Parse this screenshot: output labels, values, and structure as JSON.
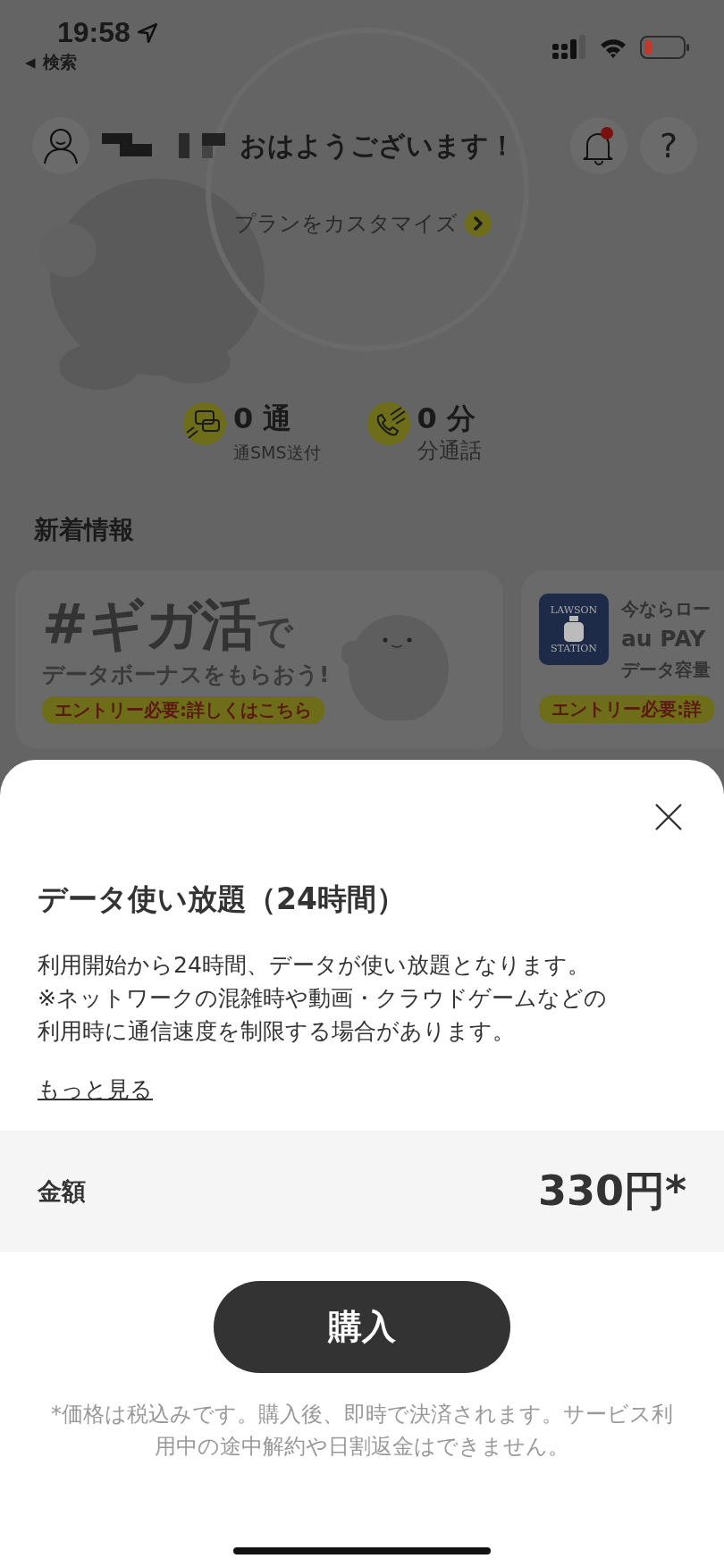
{
  "status_bar": {
    "time": "19:58",
    "back_arrow": "◀",
    "back_label": "検索"
  },
  "header": {
    "greeting": "おはようございます！",
    "notification_unread": true,
    "help_label": "?"
  },
  "plan": {
    "customize_label": "プランをカスタマイズ"
  },
  "stats": [
    {
      "kind": "sms",
      "value": "0 通",
      "label": "通SMS送付"
    },
    {
      "kind": "call",
      "value": "0 分",
      "label": "分通話"
    }
  ],
  "news": {
    "title": "新着情報",
    "cards": [
      {
        "kind": "giga",
        "headline": "#ギガ活",
        "headline_suffix": "で",
        "subline": "データボーナスをもらおう!",
        "badge": "エントリー必要:詳しくはこちら"
      },
      {
        "kind": "lawson",
        "logo_top": "LAWSON",
        "logo_bottom": "STATION",
        "lines": [
          "今ならロー",
          "au PAY",
          "データ容量"
        ],
        "badge": "エントリー必要:詳"
      }
    ]
  },
  "sheet": {
    "title": "データ使い放題（24時間）",
    "description": [
      "利用開始から24時間、データが使い放題となります。",
      "※ネットワークの混雑時や動画・クラウドゲームなどの",
      "利用時に通信速度を制限する場合があります。"
    ],
    "more_link": "もっと見る",
    "price_label": "金額",
    "price": "330円*",
    "buy_button": "購入",
    "footnote": "*価格は税込みです。購入後、即時で決済されます。サービス利用中の途中解約や日割返金はできません。"
  }
}
